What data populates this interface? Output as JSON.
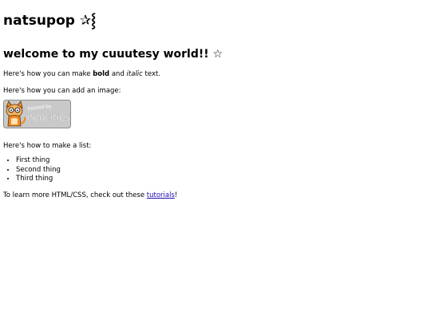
{
  "title": {
    "text": "natsupop",
    "emoji": "✰⸾"
  },
  "heading": {
    "text": "welcome to my cuuutesy world!!",
    "emoji": "☆"
  },
  "formatting_line": {
    "prefix": "Here's how you can make ",
    "bold": "bold",
    "middle": " and ",
    "italic": "italic",
    "suffix": " text."
  },
  "image_line": {
    "text": "Here's how you can add an image:"
  },
  "badge": {
    "hosted_by": "hosted by",
    "brand": "neocities",
    "icon": "neocities-cat-icon"
  },
  "list_intro": {
    "text": "Here's how to make a list:"
  },
  "list_items": [
    "First thing",
    "Second thing",
    "Third thing"
  ],
  "learn_line": {
    "prefix": "To learn more HTML/CSS, check out these ",
    "link": "tutorials",
    "suffix": "!"
  },
  "colors": {
    "link": "#1a0dab",
    "badge_bg": "#c8c8c8",
    "cat_orange": "#f08a24"
  }
}
